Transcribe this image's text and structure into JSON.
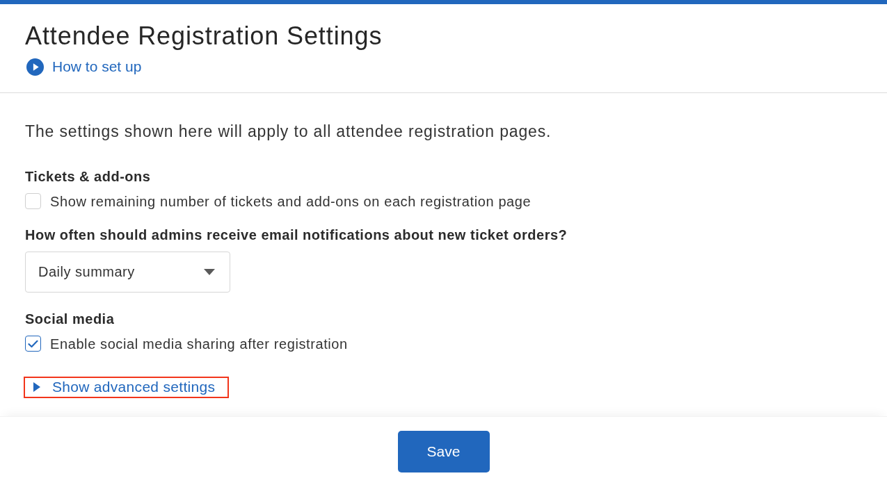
{
  "header": {
    "title": "Attendee Registration Settings",
    "help_link": "How to set up"
  },
  "description": "The settings shown here will apply to all attendee registration pages.",
  "sections": [
    {
      "kind": "checkbox",
      "heading": "Tickets & add-ons",
      "label": "Show remaining number of tickets and add-ons on each registration page",
      "checked": false
    },
    {
      "kind": "dropdown",
      "heading": "How often should admins receive email notifications about new ticket orders?",
      "value": "Daily summary"
    },
    {
      "kind": "checkbox",
      "heading": "Social media",
      "label": "Enable social media sharing after registration",
      "checked": true
    }
  ],
  "advanced_toggle": {
    "label": "Show advanced settings",
    "expanded": false,
    "highlighted": true
  },
  "buttons": [
    "Save"
  ]
}
